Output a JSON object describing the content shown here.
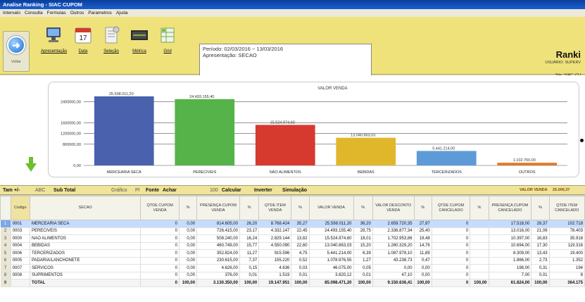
{
  "window": {
    "title": "Analise Ranking - SIAC CUPOM"
  },
  "menu": [
    "Intervalo",
    "Consulta",
    "Formulas",
    "Outros",
    "Parametros",
    "Ajuda"
  ],
  "toolbar": {
    "buttons": [
      {
        "label": "Apresentação",
        "icon": "monitor-icon"
      },
      {
        "label": "Data",
        "icon": "calendar-icon"
      },
      {
        "label": "Seleção",
        "icon": "document-icon"
      },
      {
        "label": "Métrica",
        "icon": "metric-icon"
      },
      {
        "label": "Grid",
        "icon": "grid-icon"
      }
    ],
    "back_label": "Voltar",
    "calendar_day": "17"
  },
  "period": {
    "line1": "Período: 02/03/2016 ~ 13/03/2016",
    "line2": "Apresentação: SECAO"
  },
  "header": {
    "title": "Ranki",
    "user": "USUÁRIO: SUPERV",
    "site": "Site: SIAC_CU"
  },
  "chart_data": {
    "type": "bar",
    "title": "VALOR VENDA",
    "categories": [
      "MERCEARIA SECA",
      "PERECIVEIS",
      "NAO ALIMENTOS",
      "BEBIDAS",
      "TERCERIZADOS",
      "OUTROS"
    ],
    "values": [
      2598011.2,
      2493155.4,
      1524974.6,
      1040863.03,
      544214.0,
      100750.0
    ],
    "value_labels": [
      "25.598.011,20",
      "24.493.155,40",
      "15.524.974,60",
      "13.040.863,03",
      "5.441.214,00",
      "1.102.750,00"
    ],
    "colors": [
      "#4a62ad",
      "#55b34a",
      "#d63a2f",
      "#e0b72a",
      "#5d9ad8",
      "#e07a28"
    ],
    "yticks": [
      0,
      800000,
      1200000,
      1600000,
      2400000
    ],
    "ytick_labels": [
      "0,00",
      "800000,00",
      "1200000,00",
      "1600000,00",
      "2400000,00"
    ],
    "ylim": [
      0,
      2700000
    ]
  },
  "gridtoolbar": {
    "t1": "Tam +/-",
    "t2": "ABC",
    "t3": "Sub Total",
    "t4": "Gráfico",
    "t5": "Pl",
    "t6": "Fonte",
    "t7": "Achar",
    "t8": "100",
    "t9": "Calcular",
    "t10": "Inverter",
    "t11": "Simulação",
    "t12": "VALOR VENDA",
    "t13": "25.000,37"
  },
  "grid": {
    "columns": [
      "",
      "Codigo",
      "SECAO",
      "QTDE CUPOM VENDA",
      "%",
      "PRESENÇA CUPOM VENDA",
      "%",
      "QTDE ITEM VENDA",
      "%",
      "VALOR VENDA",
      "%",
      "VALOR DESCONTO VENDA",
      "%",
      "QTDE CUPOM CANCELADO",
      "%",
      "PRESENÇA CUPOM CANCELADO",
      "%",
      "QTDE ITEM CANCELADO"
    ],
    "rows": [
      [
        "1",
        "0001",
        "MERCEARIA SECA",
        "0",
        "0,00",
        "814.605,00",
        "26,20",
        "8.768.424",
        "35,27",
        "25.598.011,20",
        "36,20",
        "2.659.720,35",
        "27,97",
        "0",
        "",
        "17.518,00",
        "28,37",
        "102.718"
      ],
      [
        "2",
        "0003",
        "PERECIVEIS",
        "0",
        "0,00",
        "726.415,00",
        "23,17",
        "4.332.147",
        "22,45",
        "24.493.155,40",
        "28,75",
        "2.336.877,34",
        "25,40",
        "0",
        "",
        "13.016,00",
        "21,06",
        "78.403"
      ],
      [
        "3",
        "0000",
        "NAO ALIMENTOS",
        "0",
        "0,00",
        "508.240,00",
        "16,24",
        "2.829.144",
        "13,82",
        "15.524.974,60",
        "18,01",
        "1.702.953,86",
        "19,48",
        "0",
        "",
        "10.397,00",
        "16,83",
        "35.918"
      ],
      [
        "4",
        "0004",
        "BEBIDAS",
        "0",
        "0,00",
        "460.749,00",
        "15,77",
        "4.550.090",
        "22,60",
        "13.040.863,03",
        "15,20",
        "1.260.329,20",
        "14,76",
        "0",
        "",
        "10.694,00",
        "17,30",
        "119.316"
      ],
      [
        "5",
        "0006",
        "TERCERIZADOS",
        "0",
        "0,00",
        "352.824,00",
        "11,27",
        "915.596",
        "4,75",
        "5.441.214,00",
        "6,39",
        "1.087.978,10",
        "11,89",
        "0",
        "",
        "8.309,00",
        "13,43",
        "19.400"
      ],
      [
        "6",
        "0005",
        "PADARIA/LANCHONETE",
        "0",
        "0,00",
        "230.615,00",
        "7,37",
        "155.220",
        "0,52",
        "1.078.976,55",
        "1,27",
        "43.238,73",
        "0,47",
        "0",
        "",
        "1.866,00",
        "2,73",
        "1.352"
      ],
      [
        "7",
        "0007",
        "SERVICOS",
        "0",
        "0,00",
        "4.626,00",
        "0,15",
        "4.636",
        "0,03",
        "46.075,00",
        "0,05",
        "0,00",
        "0,00",
        "0",
        "",
        "198,00",
        "0,31",
        "194"
      ],
      [
        "8",
        "0008",
        "SUPRIMENTOS",
        "0",
        "0,00",
        "376,00",
        "0,01",
        "1.519",
        "0,01",
        "3.820,12",
        "0,01",
        "47,10",
        "0,00",
        "0",
        "",
        "7,00",
        "0,01",
        "8"
      ],
      [
        "9",
        "",
        "TOTAL",
        "0",
        "100,00",
        "3.130.350,00",
        "100,00",
        "19.147.951",
        "100,00",
        "85.098.471,20",
        "100,00",
        "9.150.636,41",
        "100,00",
        "0",
        "100,00",
        "61.824,00",
        "100,00",
        "364.175"
      ]
    ]
  }
}
